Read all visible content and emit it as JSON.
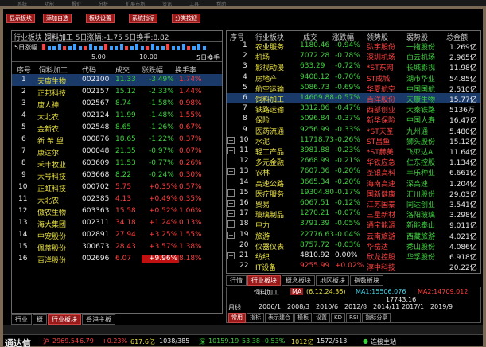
{
  "menu": [
    "系统",
    "功能",
    "报价",
    "分析",
    "扩展市场",
    "资讯",
    "工具",
    "帮助"
  ],
  "toolbar": {
    "buttons": [
      "显示板块",
      "添加自选",
      "板块设置",
      "系统指标",
      "分类按钮"
    ]
  },
  "left": {
    "header": {
      "label_industry": "行业板块",
      "sector": "饲料加工",
      "stats": "5日涨幅:-1.75 5日换手:8.82",
      "chart_label": "5日涨幅",
      "axis_left": "5.00",
      "axis_mid": "10.00",
      "axis_right": "5日换手"
    },
    "columns": [
      "序号",
      "饲料加工",
      "代码",
      "成交",
      "涨跌幅",
      "换手率"
    ],
    "rows": [
      {
        "no": "1",
        "name": "天康生物",
        "code": "002100",
        "price": "11.33",
        "chg": "-3.49%",
        "turn": "1.74%"
      },
      {
        "no": "2",
        "name": "正邦科技",
        "code": "002157",
        "price": "15.12",
        "chg": "-2.33%",
        "turn": "1.44%"
      },
      {
        "no": "3",
        "name": "唐人神",
        "code": "002567",
        "price": "8.74",
        "chg": "-1.58%",
        "turn": "0.98%"
      },
      {
        "no": "4",
        "name": "大北农",
        "code": "002124",
        "price": "11.99",
        "chg": "-1.48%",
        "turn": "1.55%"
      },
      {
        "no": "5",
        "name": "金新农",
        "code": "002548",
        "price": "8.65",
        "chg": "-1.26%",
        "turn": "0.67%"
      },
      {
        "no": "6",
        "name": "新 希 望",
        "code": "000876",
        "price": "18.65",
        "chg": "-1.22%",
        "turn": "0.37%"
      },
      {
        "no": "7",
        "name": "康达尔",
        "code": "000048",
        "price": "21.35",
        "chg": "-0.97%",
        "turn": "0.07%"
      },
      {
        "no": "8",
        "name": "禾丰牧业",
        "code": "603609",
        "price": "11.53",
        "chg": "-0.77%",
        "turn": "0.26%"
      },
      {
        "no": "9",
        "name": "大号科技",
        "code": "603668",
        "price": "8.22",
        "chg": "-0.24%",
        "turn": "0.30%"
      },
      {
        "no": "10",
        "name": "正虹科技",
        "code": "000702",
        "price": "5.75",
        "chg": "+0.35%",
        "turn": "0.57%"
      },
      {
        "no": "11",
        "name": "大北农",
        "code": "002385",
        "price": "4.13",
        "chg": "+0.49%",
        "turn": "0.35%"
      },
      {
        "no": "12",
        "name": "傲农生物",
        "code": "603363",
        "price": "15.58",
        "chg": "+0.52%",
        "turn": "1.06%"
      },
      {
        "no": "13",
        "name": "海大集团",
        "code": "002311",
        "price": "34.18",
        "chg": "+1.24%",
        "turn": "0.13%"
      },
      {
        "no": "14",
        "name": "中宠股份",
        "code": "002891",
        "price": "27.94",
        "chg": "+3.25%",
        "turn": "1.55%"
      },
      {
        "no": "15",
        "name": "佩蒂股份",
        "code": "300673",
        "price": "28.43",
        "chg": "+3.57%",
        "turn": "1.38%"
      },
      {
        "no": "16",
        "name": "百洋股份",
        "code": "002696",
        "price": "6.07",
        "chg": "+9.96%",
        "turn": "8.18%"
      }
    ],
    "tabs": [
      "行业",
      "概",
      "行业板块",
      "香港主板"
    ]
  },
  "right": {
    "columns": [
      "序号",
      "行业板块",
      "成交",
      "涨跌幅",
      "领势股",
      "弱势股",
      "总金额"
    ],
    "rows": [
      {
        "no": "1",
        "name": "农业服务",
        "price": "1180.46",
        "chg": "-0.94%",
        "lead": "弘宇股份",
        "weak": "一拖股份",
        "amt": "1.269亿"
      },
      {
        "no": "2",
        "name": "机场",
        "price": "7072.28",
        "chg": "-0.78%",
        "lead": "深圳机场",
        "weak": "白云机场",
        "amt": "2.965亿"
      },
      {
        "no": "3",
        "name": "影视动漫",
        "price": "633.29",
        "chg": "-0.72%",
        "lead": "*ST东网",
        "weak": "长城影视",
        "amt": "11.98亿"
      },
      {
        "no": "4",
        "name": "房地产",
        "price": "9408.12",
        "chg": "-0.70%",
        "lead": "ST成城",
        "weak": "湖市华业",
        "amt": "54.85亿"
      },
      {
        "no": "5",
        "name": "航空运输",
        "price": "5086.73",
        "chg": "-0.69%",
        "lead": "华夏航空",
        "weak": "中国国航",
        "amt": "2.510亿"
      },
      {
        "no": "6",
        "name": "饲料加工",
        "price": "14609.88",
        "chg": "-0.57%",
        "lead": "百洋股份",
        "weak": "天康生物",
        "amt": "15.77亿"
      },
      {
        "no": "7",
        "name": "铁路运输",
        "price": "3312.86",
        "chg": "-0.47%",
        "lead": "西部创业",
        "weak": "大秦铁路",
        "amt": "5136万"
      },
      {
        "no": "8",
        "name": "保险",
        "price": "5096.84",
        "chg": "-0.37%",
        "lead": "新华保险",
        "weak": "中国人寿",
        "amt": "16.47亿"
      },
      {
        "no": "9",
        "name": "医药流通",
        "price": "9256.99",
        "chg": "-0.33%",
        "lead": "*ST天圣",
        "weak": "九州通",
        "amt": "5.480亿"
      },
      {
        "no": "10",
        "name": "水泥",
        "price": "11718.73",
        "chg": "-0.26%",
        "lead": "ST昌鱼",
        "weak": "狮头股份",
        "amt": "15.12亿"
      },
      {
        "no": "11",
        "name": "轻工产品",
        "price": "3981.88",
        "chg": "-0.23%",
        "lead": "*ST赫美",
        "weak": "飞亚达A",
        "amt": "11.64亿"
      },
      {
        "no": "12",
        "name": "多元金融",
        "price": "2668.99",
        "chg": "-0.21%",
        "lead": "华铁应急",
        "weak": "仁东控股",
        "amt": "1.134亿"
      },
      {
        "no": "13",
        "name": "农林",
        "price": "7607.36",
        "chg": "-0.20%",
        "lead": "圣银高科",
        "weak": "丰乐种业",
        "amt": "6.661亿"
      },
      {
        "no": "14",
        "name": "高速公路",
        "price": "3665.34",
        "chg": "-0.20%",
        "lead": "海南高速",
        "weak": "深高速",
        "amt": "1.204亿"
      },
      {
        "no": "15",
        "name": "医疗服务",
        "price": "19304.80",
        "chg": "-0.17%",
        "lead": "国新健康",
        "weak": "汇川股份",
        "amt": "29.03亿"
      },
      {
        "no": "16",
        "name": "贸易",
        "price": "6067.51",
        "chg": "-0.12%",
        "lead": "江苏国泰",
        "weak": "同达创业",
        "amt": "3.541亿"
      },
      {
        "no": "17",
        "name": "玻璃制品",
        "price": "1270.21",
        "chg": "-0.07%",
        "lead": "三星新材",
        "weak": "洛阳玻璃",
        "amt": "3.298亿"
      },
      {
        "no": "18",
        "name": "电力",
        "price": "3791.39",
        "chg": "-0.05%",
        "lead": "通宝能源",
        "weak": "新能泰山",
        "amt": "9.011亿"
      },
      {
        "no": "19",
        "name": "旅游",
        "price": "22776.63",
        "chg": "-0.04%",
        "lead": "云南旅游",
        "weak": "西藏旅游",
        "amt": "4.021亿"
      },
      {
        "no": "20",
        "name": "仪器仪表",
        "price": "8757.72",
        "chg": "-0.03%",
        "lead": "华岳达",
        "weak": "秀山股份",
        "amt": "4.086亿"
      },
      {
        "no": "21",
        "name": "纺织",
        "price": "4810.92",
        "chg": "0.00%",
        "lead": "欣龙控股",
        "weak": "华孚股份",
        "amt": "6.918亿"
      },
      {
        "no": "22",
        "name": "IT设备",
        "price": "9255.99",
        "chg": "+0.02%",
        "lead": "淳中科技",
        "weak": "",
        "amt": "20.22亿"
      }
    ],
    "plus_rows": [
      10,
      11,
      13,
      15,
      16,
      17,
      18,
      19,
      21
    ],
    "tabs": [
      "行情",
      "行业板块",
      "概念板块",
      "地区板块",
      "指数板块"
    ],
    "kline": {
      "title": "饲料加工",
      "ma_label": "MA",
      "ma_params": "(6,12,24,36)",
      "ma1": "MA1:15506.076",
      "ma2": "MA2:14709.012",
      "price": "17743.16",
      "week_label": "月线",
      "years": [
        "2006/1",
        "2008/3",
        "2010/6",
        "2012/8",
        "2014/11",
        "2017/1",
        "2019/9"
      ],
      "bottom_tabs": [
        "常用",
        "指标",
        "表示建仓",
        "横板",
        "设置",
        "KD",
        "RSI",
        "指标分享"
      ]
    }
  },
  "status": {
    "index1_name": "沪",
    "index1_val": "2969.54",
    "index1_chg": "6.79",
    "index1_pct": "+0.23%",
    "index1_amt": "617.6亿",
    "index1_cnt": "1038/385",
    "index2_name": "深",
    "index2_val": "10159.19",
    "index2_chg": "53.38",
    "index2_pct": "-0.53%",
    "index2_amt": "1012亿",
    "index2_cnt": "1572/513",
    "conn": "连接主站",
    "brand": "通达信"
  },
  "colors": {
    "up": "#ff4040",
    "down": "#40d040",
    "accent": "#9a1a1a",
    "select": "#1a3a6a"
  }
}
